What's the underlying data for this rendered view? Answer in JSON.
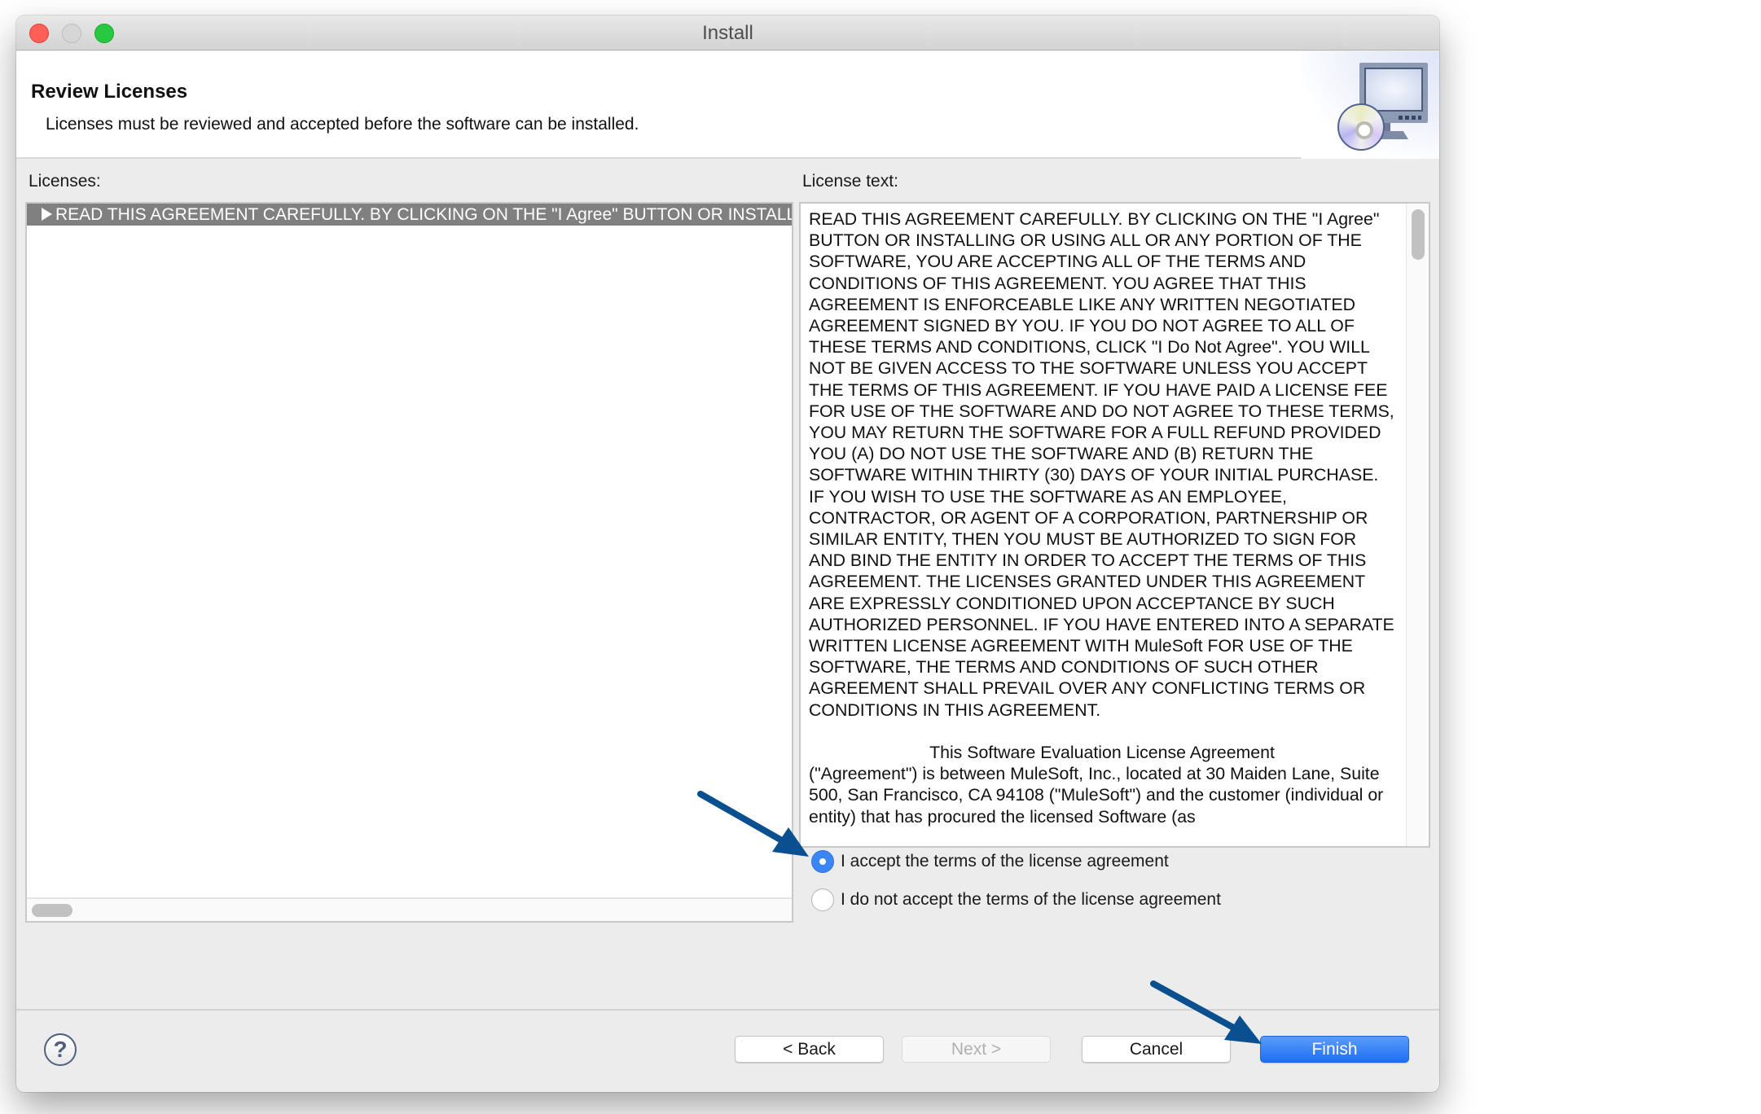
{
  "window": {
    "title": "Install",
    "controls": [
      "close",
      "minimize",
      "zoom"
    ]
  },
  "header": {
    "title": "Review Licenses",
    "subtitle": "Licenses must be reviewed and accepted before the software can be installed.",
    "icon": "install-monitor-cd-icon"
  },
  "licenses": {
    "label": "Licenses:",
    "items": [
      {
        "label": "READ THIS AGREEMENT CAREFULLY. BY CLICKING ON THE \"I Agree\" BUTTON OR INSTALLING OR USING ALL OR ANY PORTION OF THE SOFTWARE",
        "selected": true,
        "expanded": false
      }
    ]
  },
  "license_text": {
    "label": "License text:",
    "paragraph1": "READ THIS AGREEMENT CAREFULLY. BY CLICKING ON THE \"I Agree\" BUTTON OR INSTALLING OR USING ALL OR ANY PORTION OF THE SOFTWARE, YOU ARE ACCEPTING ALL OF THE TERMS AND CONDITIONS OF THIS AGREEMENT. YOU AGREE THAT THIS AGREEMENT IS ENFORCEABLE LIKE ANY WRITTEN NEGOTIATED AGREEMENT SIGNED BY YOU. IF YOU DO NOT AGREE TO ALL OF THESE TERMS AND CONDITIONS, CLICK \"I Do Not Agree\". YOU WILL NOT BE GIVEN ACCESS TO THE SOFTWARE UNLESS YOU ACCEPT THE TERMS OF THIS AGREEMENT. IF YOU HAVE PAID A LICENSE FEE FOR USE OF THE SOFTWARE AND DO NOT AGREE TO THESE TERMS, YOU MAY RETURN THE SOFTWARE FOR A FULL REFUND PROVIDED YOU (A) DO NOT USE THE SOFTWARE AND (B) RETURN THE SOFTWARE WITHIN THIRTY (30) DAYS OF YOUR INITIAL PURCHASE. IF YOU WISH TO USE THE SOFTWARE AS AN EMPLOYEE, CONTRACTOR, OR AGENT OF A CORPORATION, PARTNERSHIP OR SIMILAR ENTITY, THEN YOU MUST BE AUTHORIZED TO SIGN FOR AND BIND THE ENTITY IN ORDER TO ACCEPT THE TERMS OF THIS AGREEMENT. THE LICENSES GRANTED UNDER THIS AGREEMENT ARE EXPRESSLY CONDITIONED UPON ACCEPTANCE BY SUCH AUTHORIZED PERSONNEL. IF YOU HAVE ENTERED INTO A SEPARATE WRITTEN LICENSE AGREEMENT WITH MuleSoft FOR USE OF THE SOFTWARE, THE TERMS AND CONDITIONS OF SUCH OTHER AGREEMENT SHALL PREVAIL OVER ANY CONFLICTING TERMS OR CONDITIONS IN THIS AGREEMENT.",
    "paragraph2_heading": "This Software Evaluation License Agreement",
    "paragraph2": "(\"Agreement\") is between MuleSoft, Inc., located at 30 Maiden Lane, Suite 500, San Francisco, CA 94108 (\"MuleSoft\") and the customer (individual or entity) that has procured the licensed Software (as"
  },
  "acceptance": {
    "accept_label": "I accept the terms of the license agreement",
    "decline_label": "I do not accept the terms of the license agreement",
    "selected": "accept"
  },
  "footer": {
    "help_icon": "?",
    "back_label": "< Back",
    "next_label": "Next >",
    "next_enabled": false,
    "cancel_label": "Cancel",
    "finish_label": "Finish"
  },
  "annotations": {
    "arrow_color": "#0a4f8f",
    "targets": [
      "accept-radio",
      "finish-button"
    ]
  },
  "colors": {
    "accent": "#1f6ff5",
    "selection_row": "#808080",
    "arrow": "#0a4f8f"
  }
}
